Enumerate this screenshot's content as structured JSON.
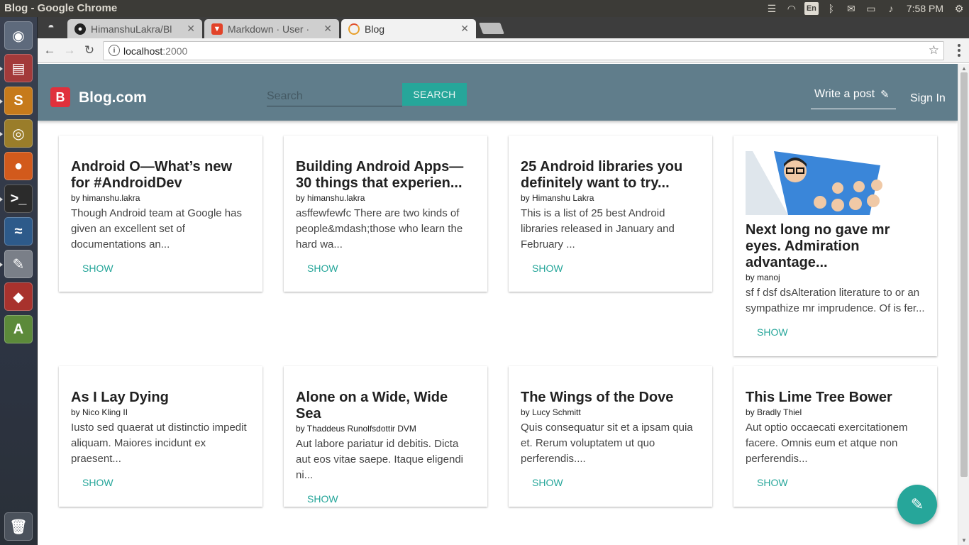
{
  "os": {
    "window_title": "Blog - Google Chrome",
    "keyboard_layout": "En",
    "clock": "7:58 PM"
  },
  "browser": {
    "tabs": [
      {
        "label": "HimanshuLakra/Bl",
        "icon": "github-icon",
        "active": false
      },
      {
        "label": "Markdown · User · ",
        "icon": "gitlab-icon",
        "active": false
      },
      {
        "label": "Blog",
        "icon": "loading-icon",
        "active": true
      }
    ],
    "url_host": "localhost",
    "url_port": ":2000"
  },
  "app": {
    "logo_letter": "B",
    "brand": "Blog.com",
    "search_placeholder": "Search",
    "search_button": "SEARCH",
    "write_post": "Write a post",
    "sign_in": "Sign In"
  },
  "posts": [
    {
      "title": "Android O—What’s new for #AndroidDev",
      "author": "by himanshu.lakra",
      "excerpt": "Though Android team at Google has given an excellent set of documentations an...",
      "action": "SHOW",
      "has_image": false
    },
    {
      "title": "Building Android Apps— 30 things that experien...",
      "author": "by himanshu.lakra",
      "excerpt": "asffewfewfc There are two kinds of people&mdash;those who learn the hard wa...",
      "action": "SHOW",
      "has_image": false
    },
    {
      "title": "25 Android libraries you definitely want to try...",
      "author": "by Himanshu Lakra",
      "excerpt": "This is a list of 25 best Android libraries released in January and February ...",
      "action": "SHOW",
      "has_image": false
    },
    {
      "title": "Next long no gave mr eyes. Admiration advantage...",
      "author": "by manoj",
      "excerpt": "sf f dsf dsAlteration literature to or an sympathize mr imprudence. Of is fer...",
      "action": "SHOW",
      "has_image": true
    },
    {
      "title": "As I Lay Dying",
      "author": "by Nico Kling II",
      "excerpt": "Iusto sed quaerat ut distinctio impedit aliquam. Maiores incidunt ex praesent...",
      "action": "SHOW",
      "has_image": false
    },
    {
      "title": "Alone on a Wide, Wide Sea",
      "author": "by Thaddeus Runolfsdottir DVM",
      "excerpt": "Aut labore pariatur id debitis. Dicta aut eos vitae saepe. Itaque eligendi ni...",
      "action": "SHOW",
      "has_image": false
    },
    {
      "title": "The Wings of the Dove",
      "author": "by Lucy Schmitt",
      "excerpt": "Quis consequatur sit et a ipsam quia et. Rerum voluptatem ut quo perferendis....",
      "action": "SHOW",
      "has_image": false
    },
    {
      "title": "This Lime Tree Bower",
      "author": "by Bradly Thiel",
      "excerpt": "Aut optio occaecati exercitationem facere. Omnis eum et atque non perferendis...",
      "action": "SHOW",
      "has_image": false
    }
  ],
  "colors": {
    "appbar": "#607d8b",
    "accent": "#26a69a",
    "logo": "#e0303c"
  }
}
